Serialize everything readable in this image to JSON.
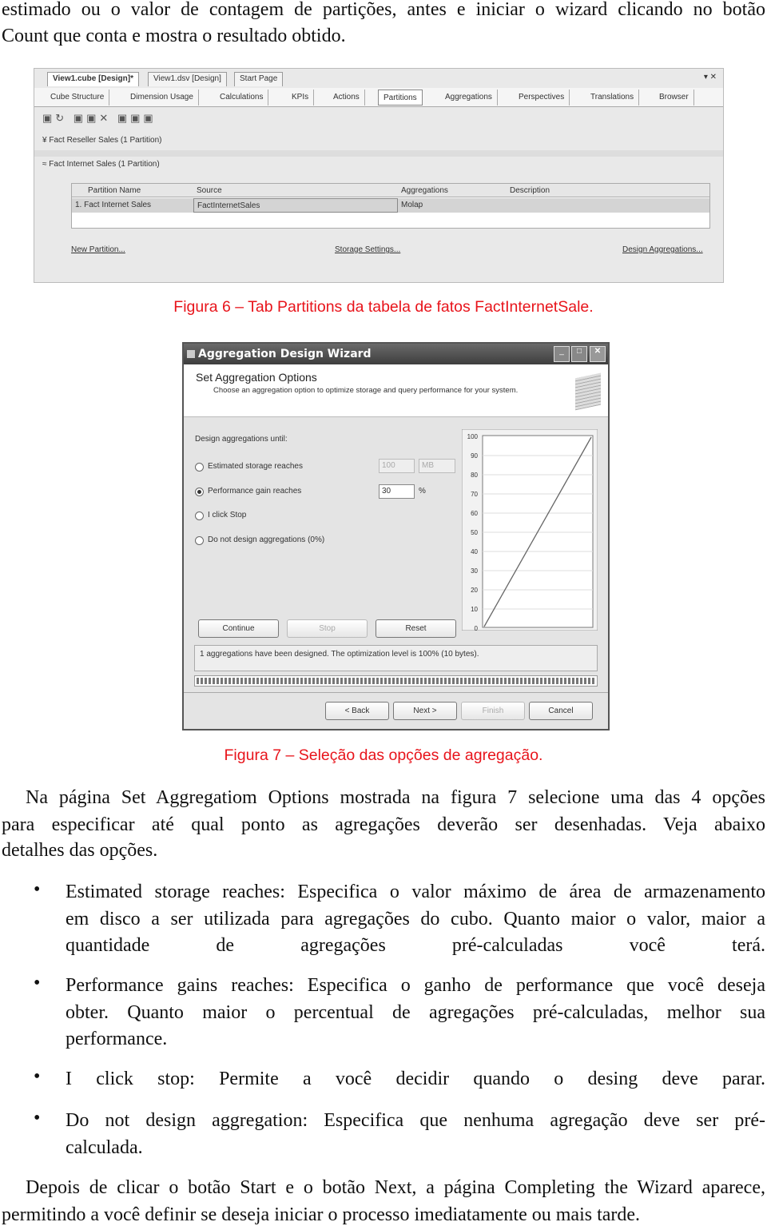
{
  "intro": [
    "estimado ou o valor de contagem de partições, antes e iniciar o wizard clicando no botão",
    "Count que conta e mostra o resultado obtido."
  ],
  "fig6": {
    "doc_tabs": [
      "View1.cube [Design]*",
      "View1.dsv [Design]",
      "Start Page"
    ],
    "close": "▾ ✕",
    "sub_tabs": [
      "Cube Structure",
      "Dimension Usage",
      "Calculations",
      "KPIs",
      "Actions",
      "Partitions",
      "Aggregations",
      "Perspectives",
      "Translations",
      "Browser"
    ],
    "groups": [
      "Fact Reseller Sales  (1 Partition)",
      "Fact Internet Sales  (1 Partition)"
    ],
    "columns": [
      "Partition Name",
      "Source",
      "Aggregations",
      "Description"
    ],
    "row": [
      "1.  Fact Internet Sales",
      "FactInternetSales",
      "Molap",
      ""
    ],
    "links": [
      "New Partition...",
      "Storage Settings...",
      "Design Aggregations..."
    ],
    "caption": "Figura 6 – Tab Partitions da tabela de fatos FactInternetSale."
  },
  "wizard": {
    "title": "Aggregation Design Wizard",
    "header": "Set Aggregation Options",
    "subheader": "Choose an aggregation option to optimize storage and query performance for your system.",
    "group_label": "Design aggregations until:",
    "options": [
      {
        "label": "Estimated storage reaches",
        "selected": false
      },
      {
        "label": "Performance gain reaches",
        "selected": true
      },
      {
        "label": "I click Stop",
        "selected": false
      },
      {
        "label": "Do not design aggregations (0%)",
        "selected": false
      }
    ],
    "storage_value": "100",
    "storage_unit": "MB",
    "perf_value": "30",
    "perf_unit": "%",
    "y_ticks": [
      "100",
      "90",
      "80",
      "70",
      "60",
      "50",
      "40",
      "30",
      "20",
      "10",
      "0"
    ],
    "buttons": {
      "continue": "Continue",
      "stop": "Stop",
      "reset": "Reset",
      "back": "< Back",
      "next": "Next >",
      "finish": "Finish",
      "cancel": "Cancel"
    },
    "status": "1 aggregations have been designed. The optimization level is 100% (10 bytes).",
    "progress": 1.0,
    "caption": "Figura 7 – Seleção das opções de agregação."
  },
  "para1": [
    "Na página Set Aggregatiom Options mostrada na figura 7 selecione uma das 4 opções",
    "para especificar até qual ponto as agregações deverão ser desenhadas. Veja abaixo",
    "detalhes das opções."
  ],
  "bullets": [
    [
      "Estimated storage reaches: Especifica o valor máximo de área de armazenamento",
      "em disco a ser utilizada para agregações do cubo. Quanto maior o valor, maior a",
      "quantidade de agregações pré-calculadas você terá."
    ],
    [
      "Performance gains reaches: Especifica o ganho de performance que você deseja",
      "obter. Quanto maior o percentual de agregações pré-calculadas, melhor sua",
      "performance."
    ],
    [
      "I click stop: Permite a você decidir quando o desing deve parar."
    ],
    [
      "Do not design aggregation: Especifica que nenhuma agregação deve ser pré-",
      "calculada."
    ]
  ],
  "para2": [
    "Depois de clicar o botão Start e o botão Next, a página Completing the Wizard aparece,",
    "permitindo a você definir se deseja iniciar o processo imediatamente ou mais tarde."
  ]
}
